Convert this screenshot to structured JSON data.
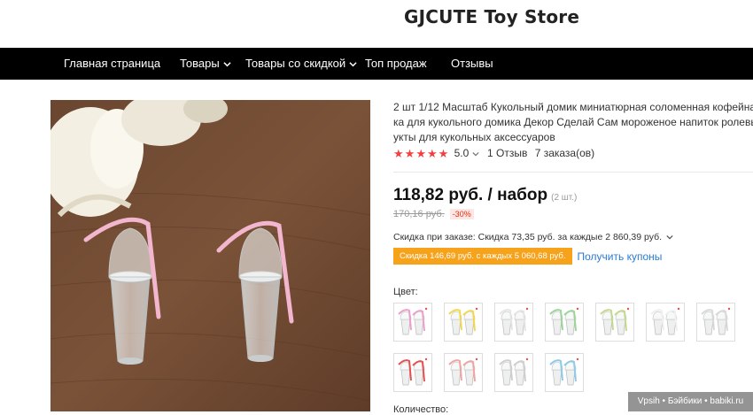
{
  "store": {
    "title": "GJCUTE Toy Store"
  },
  "nav": {
    "items": [
      {
        "label": "Главная страница",
        "has_dropdown": false
      },
      {
        "label": "Товары",
        "has_dropdown": true
      },
      {
        "label": "Товары со скидкой",
        "has_dropdown": true
      },
      {
        "label": "Топ продаж",
        "has_dropdown": false
      },
      {
        "label": "Отзывы",
        "has_dropdown": false
      }
    ]
  },
  "product": {
    "title_lines": [
      "2 шт 1/12 Масштаб Кукольный домик миниатюрная соломенная кофейна",
      "ка для кукольного домика Декор Сделай Сам мороженое напиток ролевы",
      "укты для кукольных аксессуаров"
    ],
    "rating": {
      "stars": 5,
      "value": "5.0",
      "reviews": "1 Отзыв",
      "orders": "7 заказа(ов)"
    },
    "price": {
      "current": "118,82 руб. / набор",
      "unit_note": "(2 шт.)",
      "old": "170,16 руб.",
      "discount": "-30%"
    },
    "order_discount": "Скидка при заказе: Скидка 73,35 руб. за каждые 2 860,39 руб.",
    "coupon": {
      "tag": "Скидка 146,69 руб. с каждых 5 060,68 руб.",
      "link": "Получить купоны"
    },
    "color_label": "Цвет:",
    "colors": [
      {
        "name": "pink-purple",
        "straw": "#e9a0c9"
      },
      {
        "name": "yellow",
        "straw": "#f2d84e"
      },
      {
        "name": "clear",
        "straw": "#e5e5e5"
      },
      {
        "name": "green",
        "straw": "#9fd39c"
      },
      {
        "name": "light-green",
        "straw": "#c4d98f"
      },
      {
        "name": "white",
        "straw": "#f0f0f0"
      },
      {
        "name": "grey",
        "straw": "#d9d9d9"
      },
      {
        "name": "red",
        "straw": "#e65050"
      },
      {
        "name": "pink",
        "straw": "#f2a3a3"
      },
      {
        "name": "silver",
        "straw": "#cfcfcf"
      },
      {
        "name": "blue",
        "straw": "#8ecbe8"
      }
    ],
    "quantity_label": "Количество:"
  },
  "watermark": "Vpsih • Бэйбики • babiki.ru",
  "colors": {
    "nav_bg": "#000000",
    "star": "#f23f3f",
    "coupon_bg": "#f7a21b",
    "link": "#2a7bd3",
    "discount": "#e62e04"
  }
}
